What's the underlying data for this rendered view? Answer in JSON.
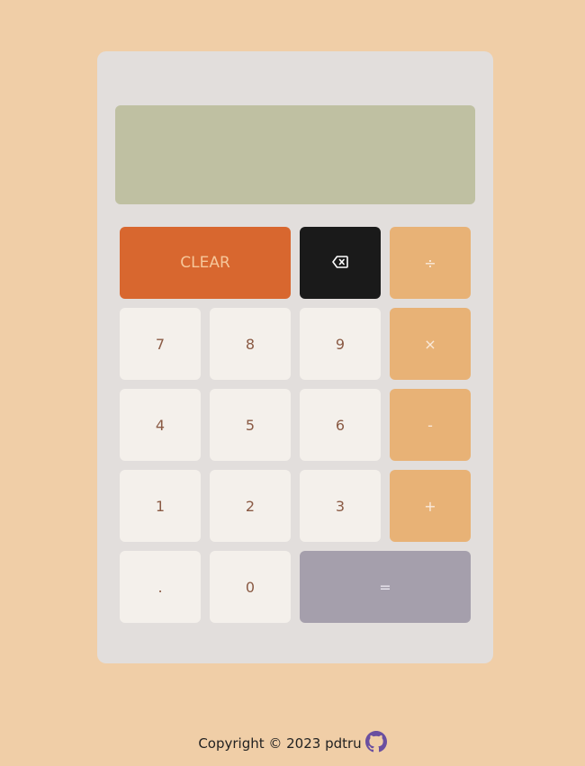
{
  "display": {
    "value": ""
  },
  "keys": {
    "clear": "CLEAR",
    "divide": "÷",
    "seven": "7",
    "eight": "8",
    "nine": "9",
    "multiply": "×",
    "four": "4",
    "five": "5",
    "six": "6",
    "subtract": "-",
    "one": "1",
    "two": "2",
    "three": "3",
    "add": "+",
    "decimal": ".",
    "zero": "0",
    "equals": "="
  },
  "icons": {
    "backspace": "backspace-icon",
    "github": "github-icon"
  },
  "footer": {
    "text": "Copyright © 2023 pdtru"
  },
  "colors": {
    "page_background": "#f0cea7",
    "calculator_body": "#e2dedc",
    "display": "#bfc0a2",
    "clear_key": "#d8672f",
    "backspace_key": "#1a1a1a",
    "operator_key": "#e8b276",
    "number_key": "#f4f0eb",
    "equals_key": "#a59fac",
    "github_icon": "#6a4fa0"
  }
}
